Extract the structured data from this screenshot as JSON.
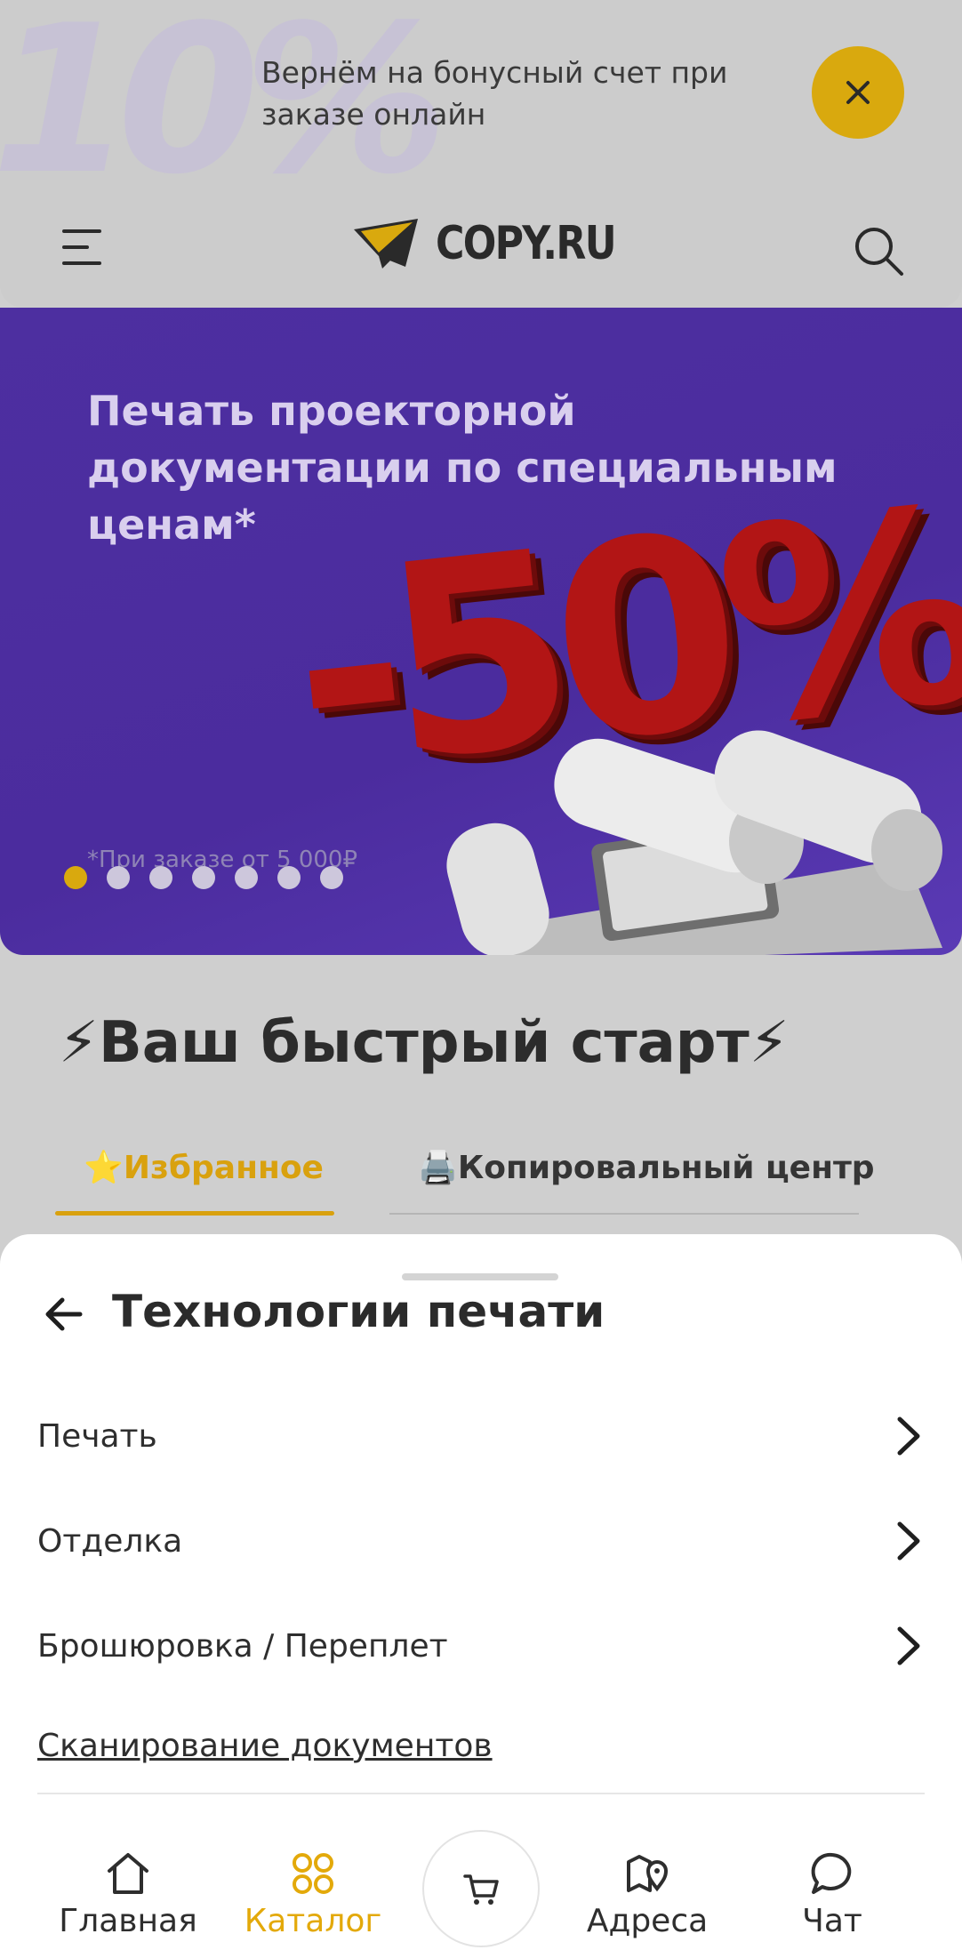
{
  "promo": {
    "badge_text": "10%",
    "text": "Вернём на бонусный счет при заказе онлайн",
    "close_icon": "close-icon",
    "accent_color": "#d9a90e"
  },
  "header": {
    "menu_icon": "hamburger-menu-icon",
    "logo_text": "COPY.RU",
    "search_icon": "search-icon"
  },
  "banner": {
    "title": "Печать проекторной документации по специальным ценам*",
    "discount": "-50%",
    "note": "*При заказе от 5 000₽",
    "slides_count": 7,
    "active_slide": 1
  },
  "quick_start": {
    "title": "⚡Ваш быстрый старт⚡",
    "tabs": [
      {
        "label": "⭐Избранное",
        "active": true
      },
      {
        "label": "🖨️Копировальный центр",
        "active": false
      }
    ]
  },
  "sheet": {
    "title": "Технологии печати",
    "back_icon": "arrow-left-icon",
    "items": [
      {
        "label": "Печать",
        "has_chevron": true
      },
      {
        "label": "Отделка",
        "has_chevron": true
      },
      {
        "label": "Брошюровка / Переплет",
        "has_chevron": true
      },
      {
        "label": "Сканирование документов",
        "has_chevron": false
      }
    ]
  },
  "nav": {
    "items": [
      {
        "label": "Главная",
        "icon": "home-icon"
      },
      {
        "label": "Каталог",
        "icon": "catalog-icon",
        "active": true
      },
      {
        "label": "Адреса",
        "icon": "map-pin-icon"
      },
      {
        "label": "Чат",
        "icon": "chat-icon"
      }
    ],
    "cart_icon": "cart-icon",
    "active_color": "#e3a90a"
  }
}
